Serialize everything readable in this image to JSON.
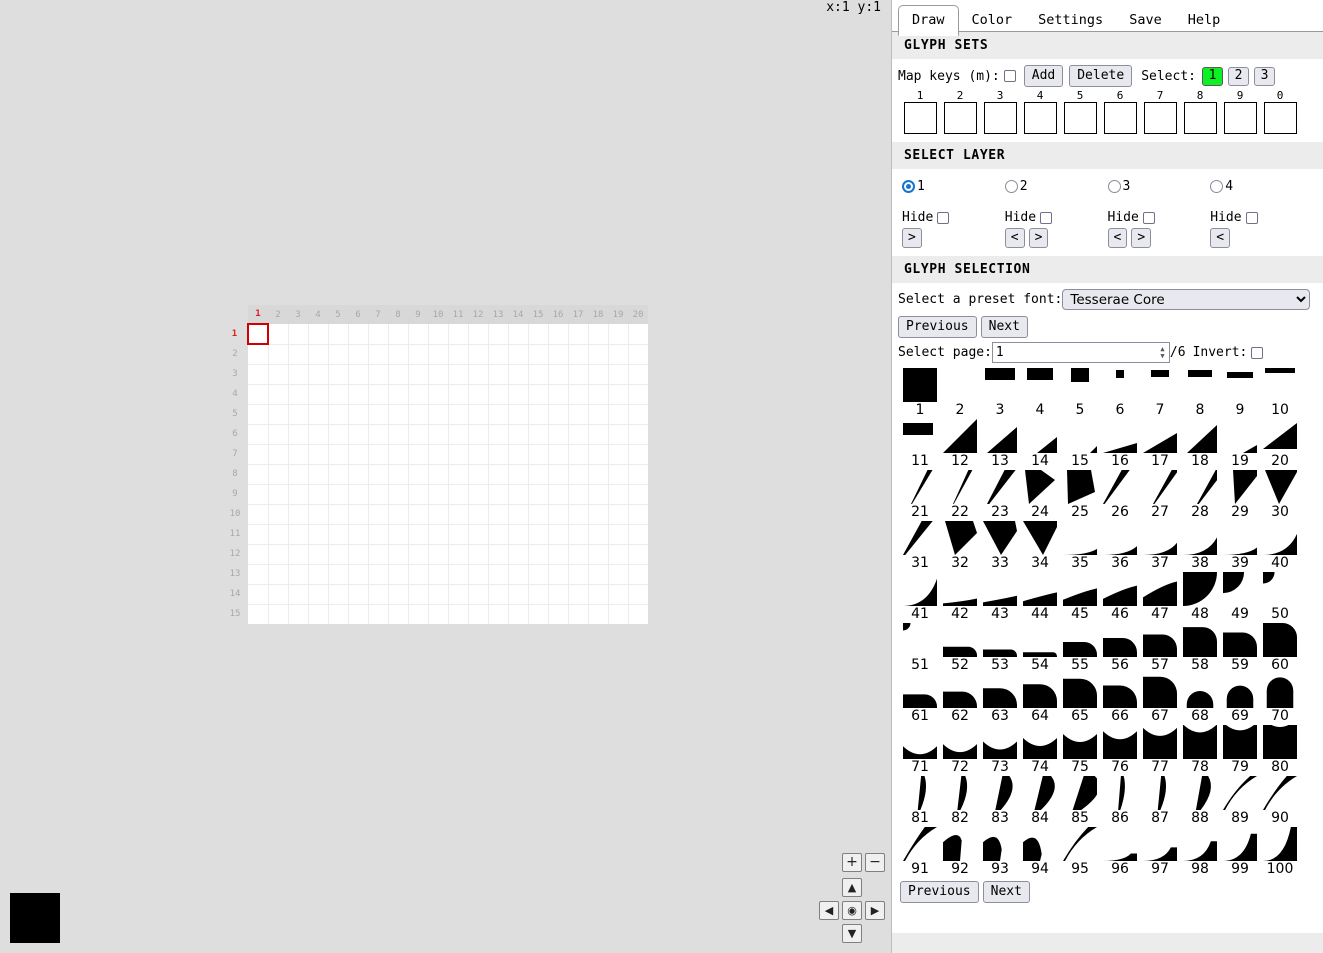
{
  "canvas": {
    "coord_readout": "x:1 y:1",
    "cols": 20,
    "rows": 15,
    "cursor_x": 1,
    "cursor_y": 1,
    "col_labels": [
      "1",
      "2",
      "3",
      "4",
      "5",
      "6",
      "7",
      "8",
      "9",
      "10",
      "11",
      "12",
      "13",
      "14",
      "15",
      "16",
      "17",
      "18",
      "19",
      "20"
    ],
    "row_labels": [
      "1",
      "2",
      "3",
      "4",
      "5",
      "6",
      "7",
      "8",
      "9",
      "10",
      "11",
      "12",
      "13",
      "14",
      "15"
    ],
    "highlight_color": "#e01b1b",
    "cell_bg": "#ffffff",
    "grid_line_color": "#ececec"
  },
  "color_swatch": {
    "name": "current-color",
    "value": "#000000"
  },
  "nav": {
    "zoom_in": "+",
    "zoom_out": "−",
    "up": "▲",
    "down": "▼",
    "left": "◀",
    "right": "▶",
    "center": "◉"
  },
  "panel": {
    "tabs": [
      {
        "label": "Draw",
        "active": true
      },
      {
        "label": "Color",
        "active": false
      },
      {
        "label": "Settings",
        "active": false
      },
      {
        "label": "Save",
        "active": false
      },
      {
        "label": "Help",
        "active": false
      }
    ],
    "glyph_sets": {
      "heading": "GLYPH SETS",
      "map_keys_label": "Map keys (m):",
      "map_keys_checked": false,
      "add_label": "Add",
      "delete_label": "Delete",
      "select_label": "Select:",
      "sets": [
        {
          "label": "1",
          "selected": true
        },
        {
          "label": "2",
          "selected": false
        },
        {
          "label": "3",
          "selected": false
        }
      ],
      "selected_set_color": "#0cf024",
      "key_slots": [
        "1",
        "2",
        "3",
        "4",
        "5",
        "6",
        "7",
        "8",
        "9",
        "0"
      ]
    },
    "select_layer": {
      "heading": "SELECT LAYER",
      "layers": [
        {
          "label": "1",
          "selected": true,
          "hide_label": "Hide",
          "hide_checked": false,
          "buttons": [
            ">"
          ]
        },
        {
          "label": "2",
          "selected": false,
          "hide_label": "Hide",
          "hide_checked": false,
          "buttons": [
            "<",
            ">"
          ]
        },
        {
          "label": "3",
          "selected": false,
          "hide_label": "Hide",
          "hide_checked": false,
          "buttons": [
            "<",
            ">"
          ]
        },
        {
          "label": "4",
          "selected": false,
          "hide_label": "Hide",
          "hide_checked": false,
          "buttons": [
            "<"
          ]
        }
      ],
      "radio_accent": "#1673d2"
    },
    "glyph_selection": {
      "heading": "GLYPH SELECTION",
      "font_label": "Select a preset font:",
      "font_selected": "Tesserae Core",
      "font_options": [
        "Tesserae Core"
      ],
      "previous_label": "Previous",
      "next_label": "Next",
      "page_label": "Select page:",
      "page_value": "1",
      "page_total": "/6",
      "invert_label": "Invert:",
      "invert_checked": false,
      "bottom_previous_label": "Previous",
      "bottom_next_label": "Next",
      "glyph_labels": [
        "1",
        "2",
        "3",
        "4",
        "5",
        "6",
        "7",
        "8",
        "9",
        "10",
        "11",
        "12",
        "13",
        "14",
        "15",
        "16",
        "17",
        "18",
        "19",
        "20",
        "21",
        "22",
        "23",
        "24",
        "25",
        "26",
        "27",
        "28",
        "29",
        "30",
        "31",
        "32",
        "33",
        "34",
        "35",
        "36",
        "37",
        "38",
        "39",
        "40",
        "41",
        "42",
        "43",
        "44",
        "45",
        "46",
        "47",
        "48",
        "49",
        "50",
        "51",
        "52",
        "53",
        "54",
        "55",
        "56",
        "57",
        "58",
        "59",
        "60",
        "61",
        "62",
        "63",
        "64",
        "65",
        "66",
        "67",
        "68",
        "69",
        "70",
        "71",
        "72",
        "73",
        "74",
        "75",
        "76",
        "77",
        "78",
        "79",
        "80",
        "81",
        "82",
        "83",
        "84",
        "85",
        "86",
        "87",
        "88",
        "89",
        "90",
        "91",
        "92",
        "93",
        "94",
        "95",
        "96",
        "97",
        "98",
        "99",
        "100"
      ],
      "glyph_shapes": [
        "rect:0,0,34,34",
        "blank",
        "rect:2,0,30,12",
        "rect:4,0,26,12",
        "rect:8,0,18,14",
        "rect:13,2,8,8",
        "rect:8,2,18,7",
        "rect:5,2,24,7",
        "rect:4,4,26,6",
        "rect:2,0,30,5",
        "rect:0,4,30,12",
        "tri:0,34,34,34,34,0",
        "tri:4,34,34,34,34,8",
        "tri:14,34,34,34,34,18",
        "tri:27,34,34,34,34,27",
        "tri:0,34,34,34,34,24",
        "tri:0,34,34,34,34,14",
        "tri:4,34,34,34,34,6",
        "tri:20,34,34,34,34,26",
        "tri:0,30,34,30,34,4",
        "slash:8,30,5",
        "slash:10,28,4",
        "slash:4,32,11",
        "slant:2,18,32,10,6",
        "slant:4,28,32,22,5",
        "slash:0,34,8",
        "slash:10,34,7",
        "slash:14,34,9",
        "slant:10,34,34,6,12",
        "slant:2,34,34,2,16",
        "slash:0,34,11",
        "slant:2,30,34,12,12",
        "slant:0,32,34,10,18",
        "slant:0,34,34,6,20",
        "curve-tr:0.18",
        "curve-tr:0.26",
        "curve-tr:0.36",
        "curve-tr:0.52",
        "curve-tr:0.22",
        "curve-tr:0.62",
        "curve-tr:0.80",
        "curve-bt:0.22",
        "curve-bt:0.30",
        "curve-bt:0.40",
        "curve-bt:0.52",
        "curve-bt:0.60",
        "curve-bt:0.72",
        "qcircle:1.00",
        "qcircle:0.62",
        "qcircle:0.34",
        "qcircle:0.22",
        "round-bl:0.30",
        "round-bl:0.22",
        "round-bl:0.14",
        "round-bl:0.44",
        "round-bl:0.56",
        "round-bl:0.66",
        "round-bl:0.88",
        "round-bl:0.72",
        "round-bl:1.00",
        "round-br:0.40",
        "round-br:0.48",
        "round-br:0.58",
        "round-br:0.70",
        "round-br:0.86",
        "round-br:0.66",
        "round-br:0.92",
        "dome:0.50",
        "dome:0.66",
        "dome:0.90",
        "cup:0.20",
        "cup:0.26",
        "cup:0.34",
        "cup:0.44",
        "cup:0.56",
        "cup:0.64",
        "cup:0.74",
        "cup:0.84",
        "cup:0.90",
        "cup:1.00",
        "blade:0.22",
        "blade:0.26",
        "blade:0.46",
        "blade:0.54",
        "blade:0.72",
        "blade:0.18",
        "blade:0.22",
        "blade:0.40",
        "wisp:0.20",
        "wisp:0.30",
        "wisp:0.36",
        "sail:0.60",
        "sail:0.34",
        "sail:0.20",
        "wisp:0.26",
        "ramp:0.22",
        "ramp:0.40",
        "ramp:0.58",
        "ramp:0.80",
        "ramp:1.00"
      ]
    },
    "section_bg": "#ececec"
  }
}
